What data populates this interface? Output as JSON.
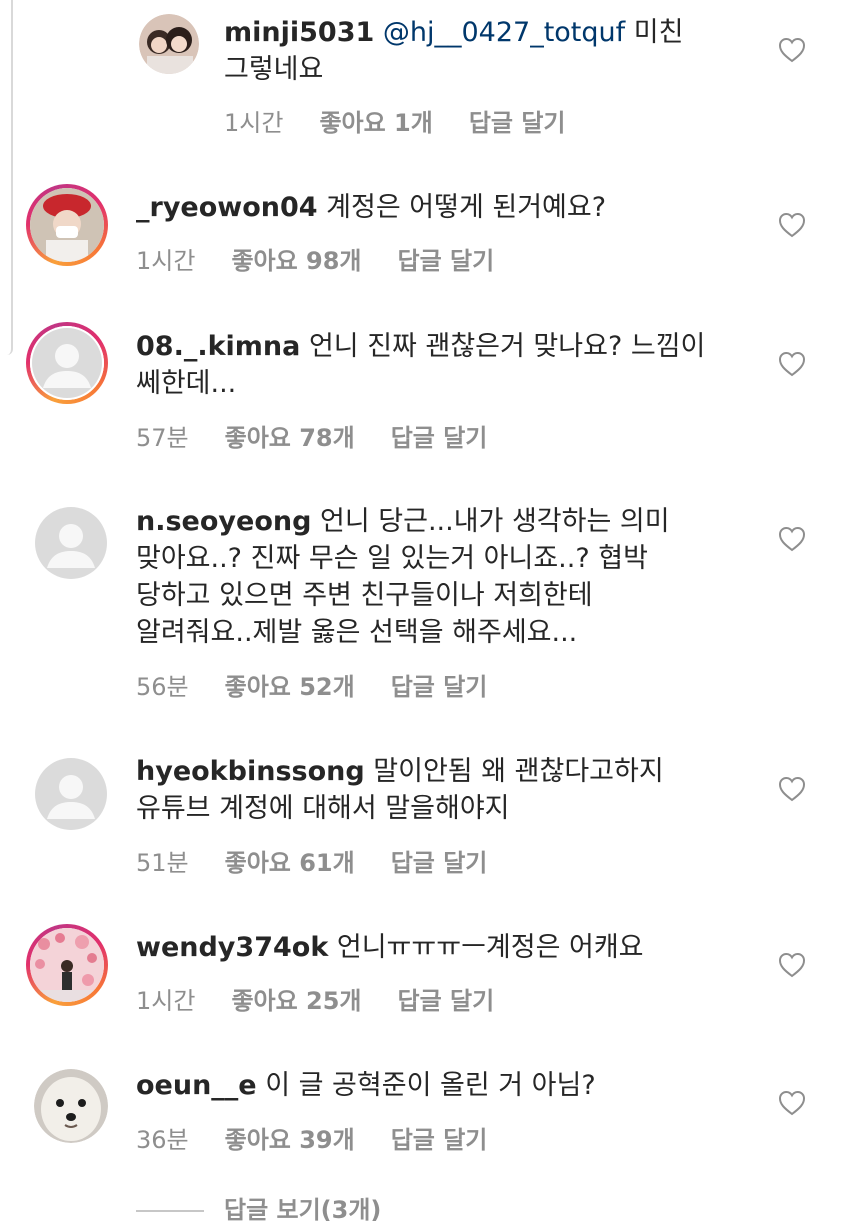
{
  "comments": [
    {
      "username": "minji5031",
      "mention": "@hj__0427_totquf",
      "text": " 미친",
      "text2": "그렇네요",
      "time": "1시간",
      "likes": "좋아요 1개",
      "reply": "답글 달기"
    },
    {
      "username": "_ryeowon04",
      "text": " 계정은 어떻게 된거예요?",
      "time": "1시간",
      "likes": "좋아요 98개",
      "reply": "답글 달기"
    },
    {
      "username": "08._.kimna",
      "text": " 언니 진짜 괜찮은거 맞나요? 느낌이",
      "text2": "쎄한데...",
      "time": "57분",
      "likes": "좋아요 78개",
      "reply": "답글 달기"
    },
    {
      "username": "n.seoyeong",
      "text": " 언니 당근...내가 생각하는 의미",
      "text2": "맞아요..? 진짜 무슨 일 있는거 아니죠..? 협박",
      "text3": "당하고 있으면 주변 친구들이나 저희한테",
      "text4": "알려줘요..제발 옳은 선택을 해주세요...",
      "time": "56분",
      "likes": "좋아요 52개",
      "reply": "답글 달기"
    },
    {
      "username": "hyeokbinssong",
      "text": " 말이안됨 왜 괜찮다고하지",
      "text2": "유튜브 계정에 대해서 말을해야지",
      "time": "51분",
      "likes": "좋아요 61개",
      "reply": "답글 달기"
    },
    {
      "username": "wendy374ok",
      "text": " 언니ㅠㅠㅠㅡ계정은 어캐요",
      "time": "1시간",
      "likes": "좋아요 25개",
      "reply": "답글 달기"
    },
    {
      "username": "oeun__e",
      "text": " 이 글 공혁준이 올린 거 아님?",
      "time": "36분",
      "likes": "좋아요 39개",
      "reply": "답글 달기"
    }
  ],
  "view_replies": "답글 보기(3개)",
  "icons": {
    "like": "heart-outline-icon",
    "avatar_default": "default-avatar-icon"
  },
  "colors": {
    "text": "#262626",
    "meta": "#8e8e8e",
    "mention": "#00376b"
  }
}
